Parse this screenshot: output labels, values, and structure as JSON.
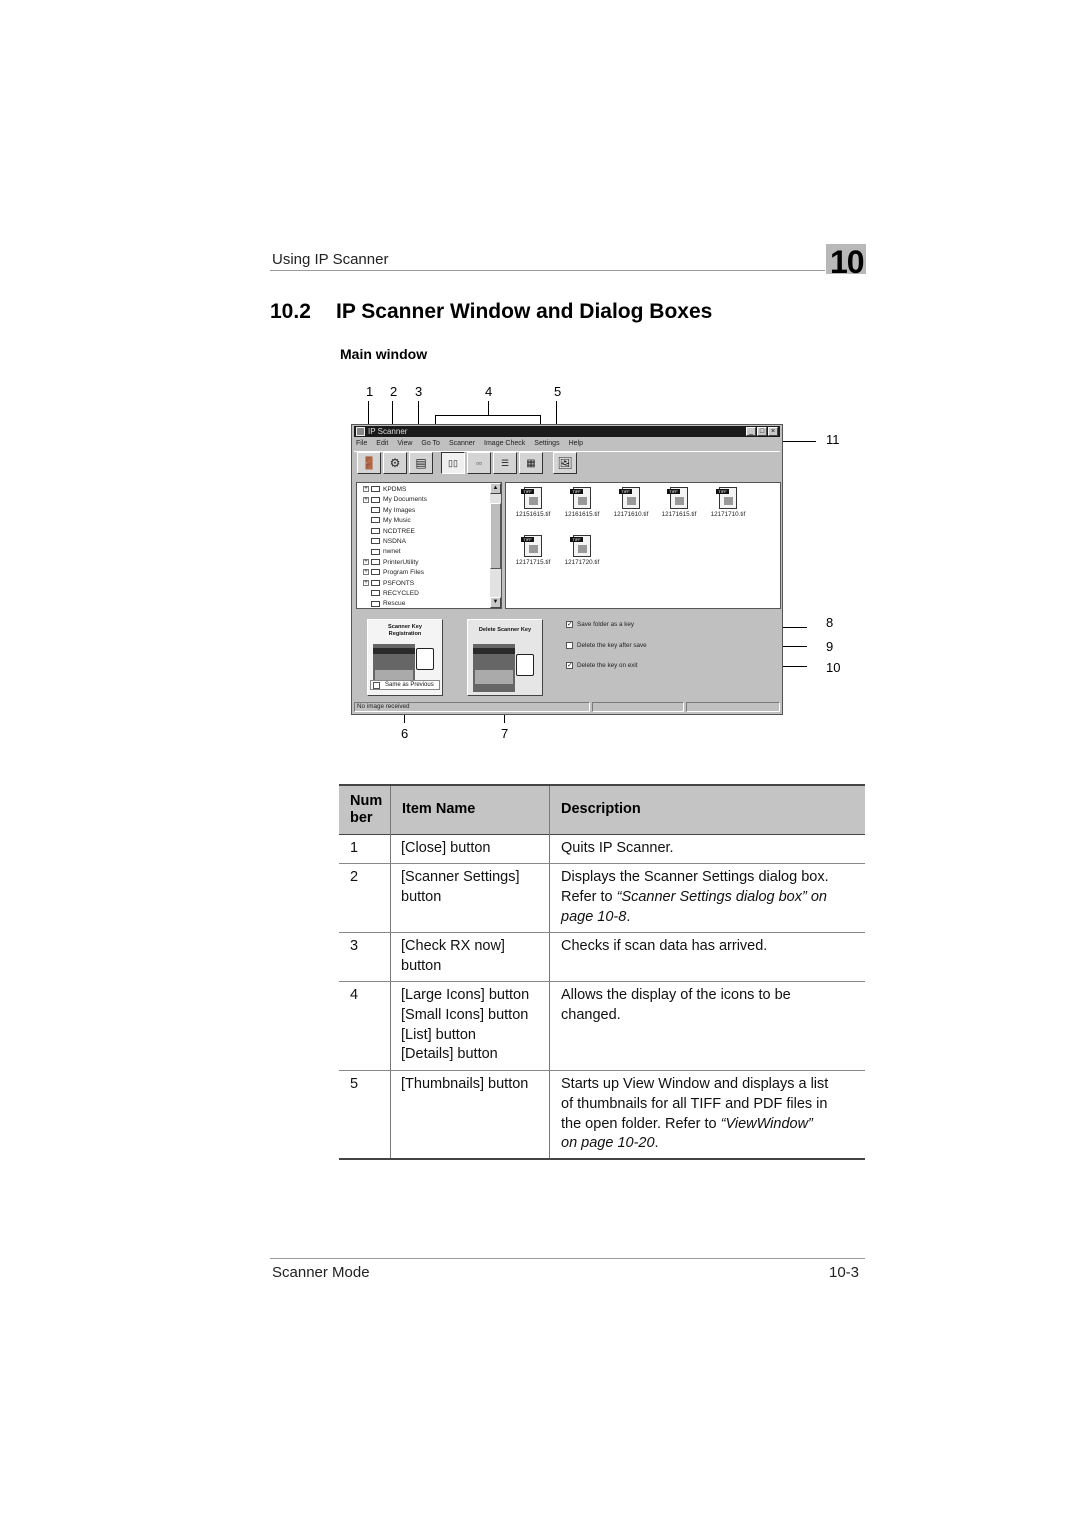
{
  "header": {
    "running_title": "Using IP Scanner",
    "chapter_number": "10"
  },
  "section": {
    "number": "10.2",
    "title": "IP Scanner Window and Dialog Boxes",
    "subtitle": "Main window"
  },
  "figure": {
    "callouts": [
      "1",
      "2",
      "3",
      "4",
      "5",
      "6",
      "7",
      "8",
      "9",
      "10",
      "11"
    ],
    "window": {
      "title": "IP Scanner",
      "window_buttons": [
        "_",
        "□",
        "×"
      ],
      "menu": [
        "File",
        "Edit",
        "View",
        "Go To",
        "Scanner",
        "Image Check",
        "Settings",
        "Help"
      ],
      "toolbar": [
        {
          "name": "close",
          "icon": "exit-icon"
        },
        {
          "name": "scanner-settings",
          "icon": "scanner-settings-icon"
        },
        {
          "name": "check-rx-now",
          "icon": "check-rx-icon"
        },
        {
          "name": "large-icons",
          "icon": "large-icons-icon",
          "pressed": true
        },
        {
          "name": "small-icons",
          "icon": "small-icons-icon"
        },
        {
          "name": "list",
          "icon": "list-icon"
        },
        {
          "name": "details",
          "icon": "details-icon"
        },
        {
          "name": "thumbnails",
          "icon": "thumbnails-icon"
        }
      ],
      "folder_tree": [
        {
          "label": "KPDMS",
          "expandable": true
        },
        {
          "label": "My Documents",
          "expandable": true
        },
        {
          "label": "My Images",
          "expandable": false
        },
        {
          "label": "My Music",
          "expandable": false
        },
        {
          "label": "NCDTREE",
          "expandable": false
        },
        {
          "label": "NSDNA",
          "expandable": false
        },
        {
          "label": "nwnet",
          "expandable": false
        },
        {
          "label": "PrinterUtility",
          "expandable": true
        },
        {
          "label": "Program Files",
          "expandable": true
        },
        {
          "label": "PSFONTS",
          "expandable": true
        },
        {
          "label": "RECYCLED",
          "expandable": false
        },
        {
          "label": "Rescue",
          "expandable": false
        }
      ],
      "files": [
        {
          "name": "12151615.tif",
          "badge": "TIFF"
        },
        {
          "name": "12161615.tif",
          "badge": "TIFF"
        },
        {
          "name": "12171610.tif",
          "badge": "TIFF"
        },
        {
          "name": "12171615.tif",
          "badge": "TIFF"
        },
        {
          "name": "12171710.tif",
          "badge": "TIFF"
        },
        {
          "name": "12171715.tif",
          "badge": "TIFF"
        },
        {
          "name": "12171720.tif",
          "badge": "TIFF"
        }
      ],
      "key_buttons": {
        "register": {
          "title_line1": "Scanner Key",
          "title_line2": "Registration",
          "same_as_previous": "Same as Previous",
          "same_as_previous_checked": false
        },
        "delete": {
          "title": "Delete Scanner Key"
        }
      },
      "options": [
        {
          "label": "Save folder as a key",
          "checked": true,
          "mark": "✓"
        },
        {
          "label": "Delete the key after save",
          "checked": false,
          "mark": ""
        },
        {
          "label": "Delete the key on exit",
          "checked": true,
          "mark": "✓"
        }
      ],
      "status": {
        "message": "No image received",
        "panel2": "",
        "panel3": ""
      }
    }
  },
  "table": {
    "headers": {
      "number_line1": "Num",
      "number_line2": "ber",
      "item_name": "Item Name",
      "description": "Description"
    },
    "rows": [
      {
        "number": "1",
        "item": [
          "[Close] button"
        ],
        "desc_plain": "Quits IP Scanner.",
        "desc_ref_prefix": "",
        "desc_ref_italic": "",
        "desc_ref_suffix": ""
      },
      {
        "number": "2",
        "item": [
          "[Scanner Settings]",
          "button"
        ],
        "desc_plain": "Displays the Scanner Settings dialog box.",
        "desc_ref_prefix": "Refer to ",
        "desc_ref_italic": "“Scanner Settings dialog box” on",
        "desc_ref_italic2": "page 10-8",
        "desc_ref_suffix": "."
      },
      {
        "number": "3",
        "item": [
          "[Check RX now]",
          "button"
        ],
        "desc_plain": "Checks if scan data has arrived."
      },
      {
        "number": "4",
        "item": [
          "[Large Icons] button",
          "[Small Icons] button",
          "[List] button",
          "[Details] button"
        ],
        "desc_line1": "Allows the display of the icons to be",
        "desc_line2": "changed."
      },
      {
        "number": "5",
        "item": [
          "[Thumbnails] button"
        ],
        "desc_line1": "Starts up View Window and displays a list",
        "desc_line2": "of thumbnails for all TIFF and PDF files in",
        "desc_line3_prefix": "the open folder. Refer to ",
        "desc_line3_italic": "“ViewWindow”",
        "desc_line4_italic": "on page 10-20",
        "desc_line4_suffix": "."
      }
    ]
  },
  "footer": {
    "left": "Scanner Mode",
    "right": "10-3"
  }
}
